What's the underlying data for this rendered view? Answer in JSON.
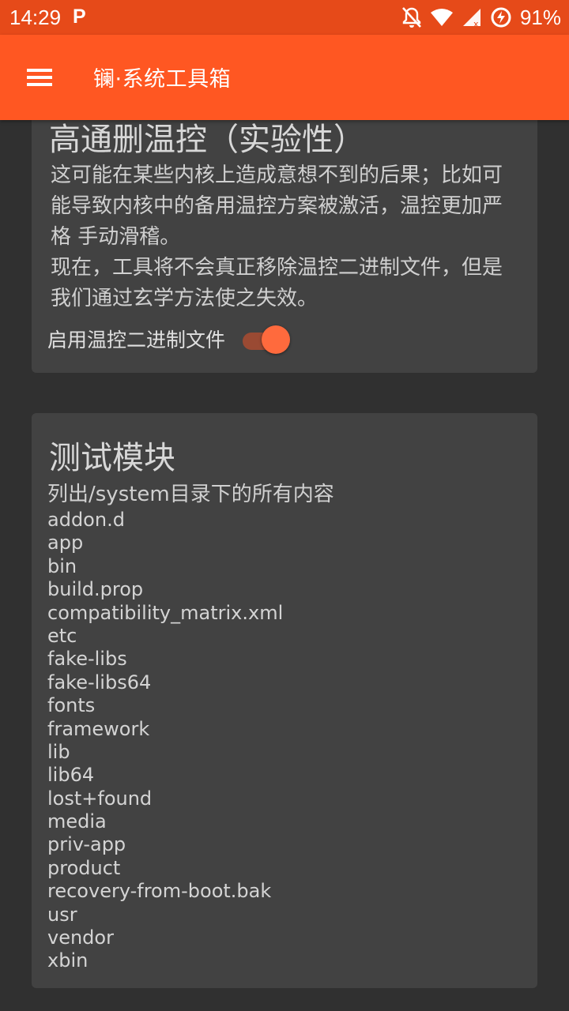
{
  "status_bar": {
    "time": "14:29",
    "notification_icon": "P",
    "battery_percent": "91%",
    "icons": [
      "notifications-off-icon",
      "wifi-icon",
      "signal-icon",
      "battery-saver-icon"
    ]
  },
  "toolbar": {
    "title": "镧·系统工具箱",
    "menu_icon": "hamburger-menu-icon",
    "color": "#ff5722"
  },
  "thermal_card": {
    "title": "高通删温控（实验性）",
    "description_lines": [
      "这可能在某些内核上造成意想不到的后果；比如可",
      "能导致内核中的备用温控方案被激活，温控更加严",
      "格 手动滑稽。",
      "现在，工具将不会真正移除温控二进制文件，但是",
      "我们通过玄学方法使之失效。"
    ],
    "toggle_label": "启用温控二进制文件",
    "toggle_on": true
  },
  "test_card": {
    "title": "测试模块",
    "subtitle": "列出/system目录下的所有内容",
    "entries": [
      "addon.d",
      "app",
      "bin",
      "build.prop",
      "compatibility_matrix.xml",
      "etc",
      "fake-libs",
      "fake-libs64",
      "fonts",
      "framework",
      "lib",
      "lib64",
      "lost+found",
      "media",
      "priv-app",
      "product",
      "recovery-from-boot.bak",
      "usr",
      "vendor",
      "xbin"
    ]
  },
  "colors": {
    "status_bar": "#e64a19",
    "accent": "#ff5722",
    "card": "#424242",
    "background": "#303030"
  }
}
